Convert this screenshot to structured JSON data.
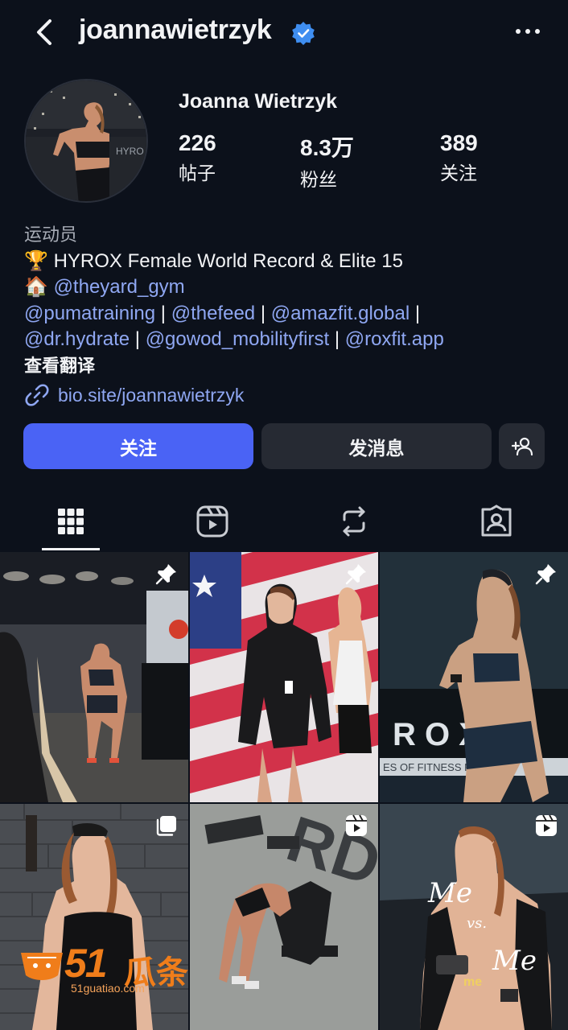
{
  "header": {
    "username": "joannawietrzyk",
    "verified_icon": "verified-badge-icon",
    "back_icon": "chevron-left-icon",
    "more_icon": "more-horizontal-icon"
  },
  "profile": {
    "display_name": "Joanna Wietrzyk",
    "stats": [
      {
        "value": "226",
        "label": "帖子"
      },
      {
        "value": "8.3万",
        "label": "粉丝"
      },
      {
        "value": "389",
        "label": "关注"
      }
    ]
  },
  "bio": {
    "category": "运动员",
    "line1_emoji": "🏆",
    "line1_text": "HYROX Female World Record & Elite 15",
    "line2_emoji": "🏠",
    "line2_mention": "@theyard_gym",
    "mentions_row1": [
      "@pumatraining",
      "@thefeed",
      "@amazfit.global"
    ],
    "mentions_row2": [
      "@dr.hydrate",
      "@gowod_mobilityfirst",
      "@roxfit.app"
    ],
    "separator": "|",
    "translate": "查看翻译",
    "link": "bio.site/joannawietrzyk"
  },
  "actions": {
    "follow_label": "关注",
    "message_label": "发消息",
    "suggest_icon": "person-add-icon"
  },
  "tabs": [
    {
      "name": "posts",
      "icon": "grid-icon",
      "active": true
    },
    {
      "name": "reels",
      "icon": "reels-icon",
      "active": false
    },
    {
      "name": "reposts",
      "icon": "repost-icon",
      "active": false
    },
    {
      "name": "tagged",
      "icon": "tagged-person-icon",
      "active": false
    }
  ],
  "grid": {
    "posts": [
      {
        "badge": "pin-icon"
      },
      {
        "badge": "pin-icon"
      },
      {
        "badge": "pin-icon"
      },
      {
        "badge": "carousel-icon"
      },
      {
        "badge": "reels-icon"
      },
      {
        "badge": "reels-icon"
      }
    ],
    "photo_text": {
      "post3_banner": "R O X",
      "post3_strip": "ES OF FITNESS R",
      "post5_floor": "RD",
      "post6_me_top": "Me",
      "post6_vs": "vs.",
      "post6_me_bottom": "Me",
      "post6_caption": "me"
    },
    "watermark": {
      "number": "51",
      "chinese": "瓜条",
      "url": "51guatiao.com"
    }
  },
  "colors": {
    "background": "#0c111b",
    "accent_button": "#4a63f5",
    "secondary_button": "#262a33",
    "link": "#8fa7f2",
    "verified": "#3f8ef0"
  }
}
